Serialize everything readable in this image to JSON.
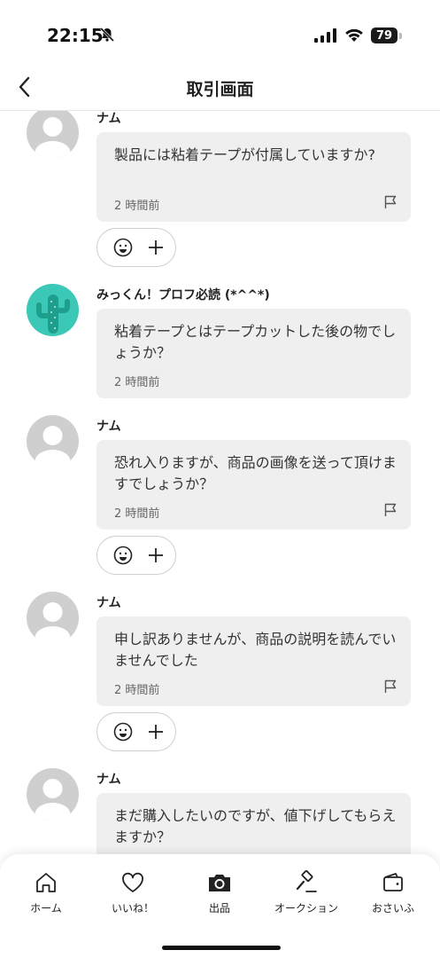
{
  "status_bar": {
    "time": "22:15",
    "battery": "79"
  },
  "nav": {
    "title": "取引画面"
  },
  "messages": [
    {
      "user": "ナム",
      "text": "製品には粘着テープが付属していますか?",
      "time": "2 時間前"
    },
    {
      "user": "みっくん！プロフ必読 (*^^*)",
      "text": "粘着テープとはテープカットした後の物でしょうか？",
      "time": "2 時間前"
    },
    {
      "user": "ナム",
      "text": "恐れ入りますが、商品の画像を送って頂けますでしょうか？",
      "time": "2 時間前"
    },
    {
      "user": "ナム",
      "text": "申し訳ありませんが、商品の説明を読んでいませんでした",
      "time": "2 時間前"
    },
    {
      "user": "ナム",
      "text": "まだ購入したいのですが、値下げしてもらえますか？",
      "time": ""
    }
  ],
  "reaction": {
    "icon": "smile-icon",
    "add_icon": "plus-icon"
  },
  "tab_bar": {
    "items": [
      {
        "label": "ホーム",
        "icon": "home-icon"
      },
      {
        "label": "いいね！",
        "icon": "heart-icon"
      },
      {
        "label": "出品",
        "icon": "camera-icon"
      },
      {
        "label": "オークション",
        "icon": "gavel-icon"
      },
      {
        "label": "おさいふ",
        "icon": "wallet-icon"
      }
    ]
  },
  "colors": {
    "bubble": "#efefef",
    "avatar_default": "#cfcfcf",
    "avatar_cactus": "#3cc8b6"
  }
}
